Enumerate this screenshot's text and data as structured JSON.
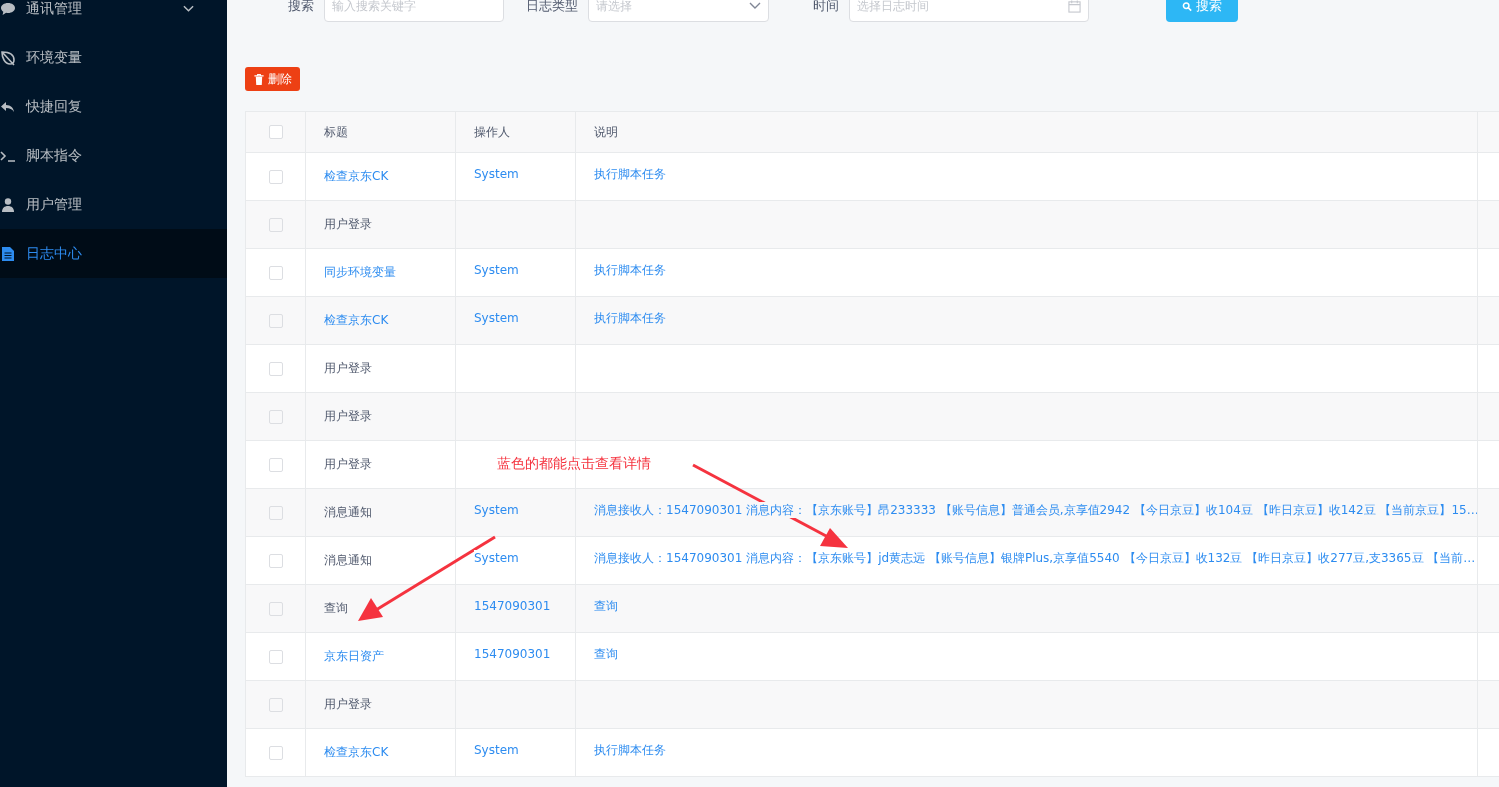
{
  "sidebar": {
    "items": [
      {
        "label": "通讯管理",
        "submenu": true,
        "selected": false
      },
      {
        "label": "环境变量",
        "submenu": false,
        "selected": false
      },
      {
        "label": "快捷回复",
        "submenu": false,
        "selected": false
      },
      {
        "label": "脚本指令",
        "submenu": false,
        "selected": false
      },
      {
        "label": "用户管理",
        "submenu": false,
        "selected": false
      },
      {
        "label": "日志中心",
        "submenu": false,
        "selected": true
      }
    ]
  },
  "filters": {
    "search": {
      "label": "搜索",
      "placeholder": "输入搜索关键字"
    },
    "type": {
      "label": "日志类型",
      "placeholder": "请选择"
    },
    "time": {
      "label": "时间",
      "placeholder": "选择日志时间"
    },
    "search_button": "搜索"
  },
  "delete_button": "删除",
  "table": {
    "header_checked": false,
    "columns": [
      "标题",
      "操作人",
      "说明"
    ],
    "rows": [
      {
        "checked": false,
        "title": "检查京东CK",
        "title_link": true,
        "operator": "System",
        "description": "执行脚本任务"
      },
      {
        "checked": false,
        "title": "用户登录",
        "title_link": false,
        "operator": "",
        "description": ""
      },
      {
        "checked": false,
        "title": "同步环境变量",
        "title_link": true,
        "operator": "System",
        "description": "执行脚本任务"
      },
      {
        "checked": false,
        "title": "检查京东CK",
        "title_link": true,
        "operator": "System",
        "description": "执行脚本任务"
      },
      {
        "checked": false,
        "title": "用户登录",
        "title_link": false,
        "operator": "",
        "description": ""
      },
      {
        "checked": false,
        "title": "用户登录",
        "title_link": false,
        "operator": "",
        "description": ""
      },
      {
        "checked": false,
        "title": "用户登录",
        "title_link": false,
        "operator": "",
        "description": ""
      },
      {
        "checked": false,
        "title": "消息通知",
        "title_link": false,
        "operator": "System",
        "description": "消息接收人：1547090301 消息内容：【京东账号】昂233333 【账号信息】普通会员,京享值2942 【今日京豆】收104豆 【昨日京豆】收142豆 【当前京豆】15…"
      },
      {
        "checked": false,
        "title": "消息通知",
        "title_link": false,
        "operator": "System",
        "description": "消息接收人：1547090301 消息内容：【京东账号】jd黄志远 【账号信息】银牌Plus,京享值5540 【今日京豆】收132豆 【昨日京豆】收277豆,支3365豆 【当前…"
      },
      {
        "checked": false,
        "title": "查询",
        "title_link": false,
        "operator": "1547090301",
        "description": "查询"
      },
      {
        "checked": false,
        "title": "京东日资产",
        "title_link": true,
        "operator": "1547090301",
        "description": "查询"
      },
      {
        "checked": false,
        "title": "用户登录",
        "title_link": false,
        "operator": "",
        "description": ""
      },
      {
        "checked": false,
        "title": "检查京东CK",
        "title_link": true,
        "operator": "System",
        "description": "执行脚本任务"
      }
    ]
  },
  "annotation": {
    "text": "蓝色的都能点击查看详情"
  }
}
